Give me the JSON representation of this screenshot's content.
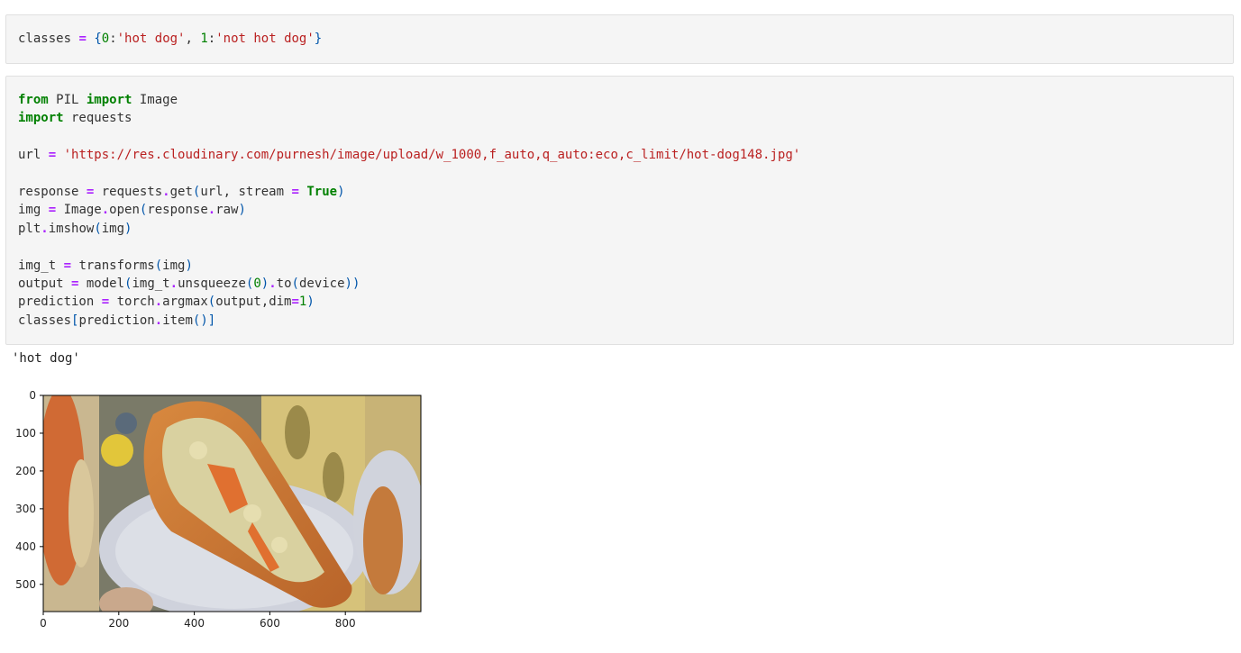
{
  "cells": [
    {
      "lines": [
        [
          [
            "t",
            "classes "
          ],
          [
            "op",
            "="
          ],
          [
            "t",
            " "
          ],
          [
            "br",
            "{"
          ],
          [
            "num",
            "0"
          ],
          [
            "t",
            ":"
          ],
          [
            "str",
            "'hot dog'"
          ],
          [
            "t",
            ", "
          ],
          [
            "num",
            "1"
          ],
          [
            "t",
            ":"
          ],
          [
            "str",
            "'not hot dog'"
          ],
          [
            "br",
            "}"
          ]
        ]
      ]
    },
    {
      "lines": [
        [
          [
            "kw",
            "from"
          ],
          [
            "t",
            " PIL "
          ],
          [
            "kw",
            "import"
          ],
          [
            "t",
            " Image"
          ]
        ],
        [
          [
            "kw",
            "import"
          ],
          [
            "t",
            " requests"
          ]
        ],
        [],
        [
          [
            "t",
            "url "
          ],
          [
            "op",
            "="
          ],
          [
            "t",
            " "
          ],
          [
            "str",
            "'https://res.cloudinary.com/purnesh/image/upload/w_1000,f_auto,q_auto:eco,c_limit/hot-dog148.jpg'"
          ]
        ],
        [],
        [
          [
            "t",
            "response "
          ],
          [
            "op",
            "="
          ],
          [
            "t",
            " requests"
          ],
          [
            "op",
            "."
          ],
          [
            "t",
            "get"
          ],
          [
            "br",
            "("
          ],
          [
            "t",
            "url, stream "
          ],
          [
            "op",
            "="
          ],
          [
            "t",
            " "
          ],
          [
            "kw",
            "True"
          ],
          [
            "br",
            ")"
          ]
        ],
        [
          [
            "t",
            "img "
          ],
          [
            "op",
            "="
          ],
          [
            "t",
            " Image"
          ],
          [
            "op",
            "."
          ],
          [
            "t",
            "open"
          ],
          [
            "br",
            "("
          ],
          [
            "t",
            "response"
          ],
          [
            "op",
            "."
          ],
          [
            "t",
            "raw"
          ],
          [
            "br",
            ")"
          ]
        ],
        [
          [
            "t",
            "plt"
          ],
          [
            "op",
            "."
          ],
          [
            "t",
            "imshow"
          ],
          [
            "br",
            "("
          ],
          [
            "t",
            "img"
          ],
          [
            "br",
            ")"
          ]
        ],
        [],
        [
          [
            "t",
            "img_t "
          ],
          [
            "op",
            "="
          ],
          [
            "t",
            " transforms"
          ],
          [
            "br",
            "("
          ],
          [
            "t",
            "img"
          ],
          [
            "br",
            ")"
          ]
        ],
        [
          [
            "t",
            "output "
          ],
          [
            "op",
            "="
          ],
          [
            "t",
            " model"
          ],
          [
            "br",
            "("
          ],
          [
            "t",
            "img_t"
          ],
          [
            "op",
            "."
          ],
          [
            "t",
            "unsqueeze"
          ],
          [
            "br",
            "("
          ],
          [
            "num",
            "0"
          ],
          [
            "br",
            ")"
          ],
          [
            "op",
            "."
          ],
          [
            "t",
            "to"
          ],
          [
            "br",
            "("
          ],
          [
            "t",
            "device"
          ],
          [
            "br",
            "))"
          ]
        ],
        [
          [
            "t",
            "prediction "
          ],
          [
            "op",
            "="
          ],
          [
            "t",
            " torch"
          ],
          [
            "op",
            "."
          ],
          [
            "t",
            "argmax"
          ],
          [
            "br",
            "("
          ],
          [
            "t",
            "output,dim"
          ],
          [
            "op",
            "="
          ],
          [
            "num",
            "1"
          ],
          [
            "br",
            ")"
          ]
        ],
        [
          [
            "t",
            "classes"
          ],
          [
            "br",
            "["
          ],
          [
            "t",
            "prediction"
          ],
          [
            "op",
            "."
          ],
          [
            "t",
            "item"
          ],
          [
            "br",
            "()]"
          ]
        ]
      ]
    }
  ],
  "output": {
    "text": "'hot dog'"
  },
  "plot": {
    "y_ticks": [
      "0",
      "100",
      "200",
      "300",
      "400",
      "500"
    ],
    "x_ticks": [
      "0",
      "200",
      "400",
      "600",
      "800"
    ],
    "image_alt": "hot dog image"
  }
}
